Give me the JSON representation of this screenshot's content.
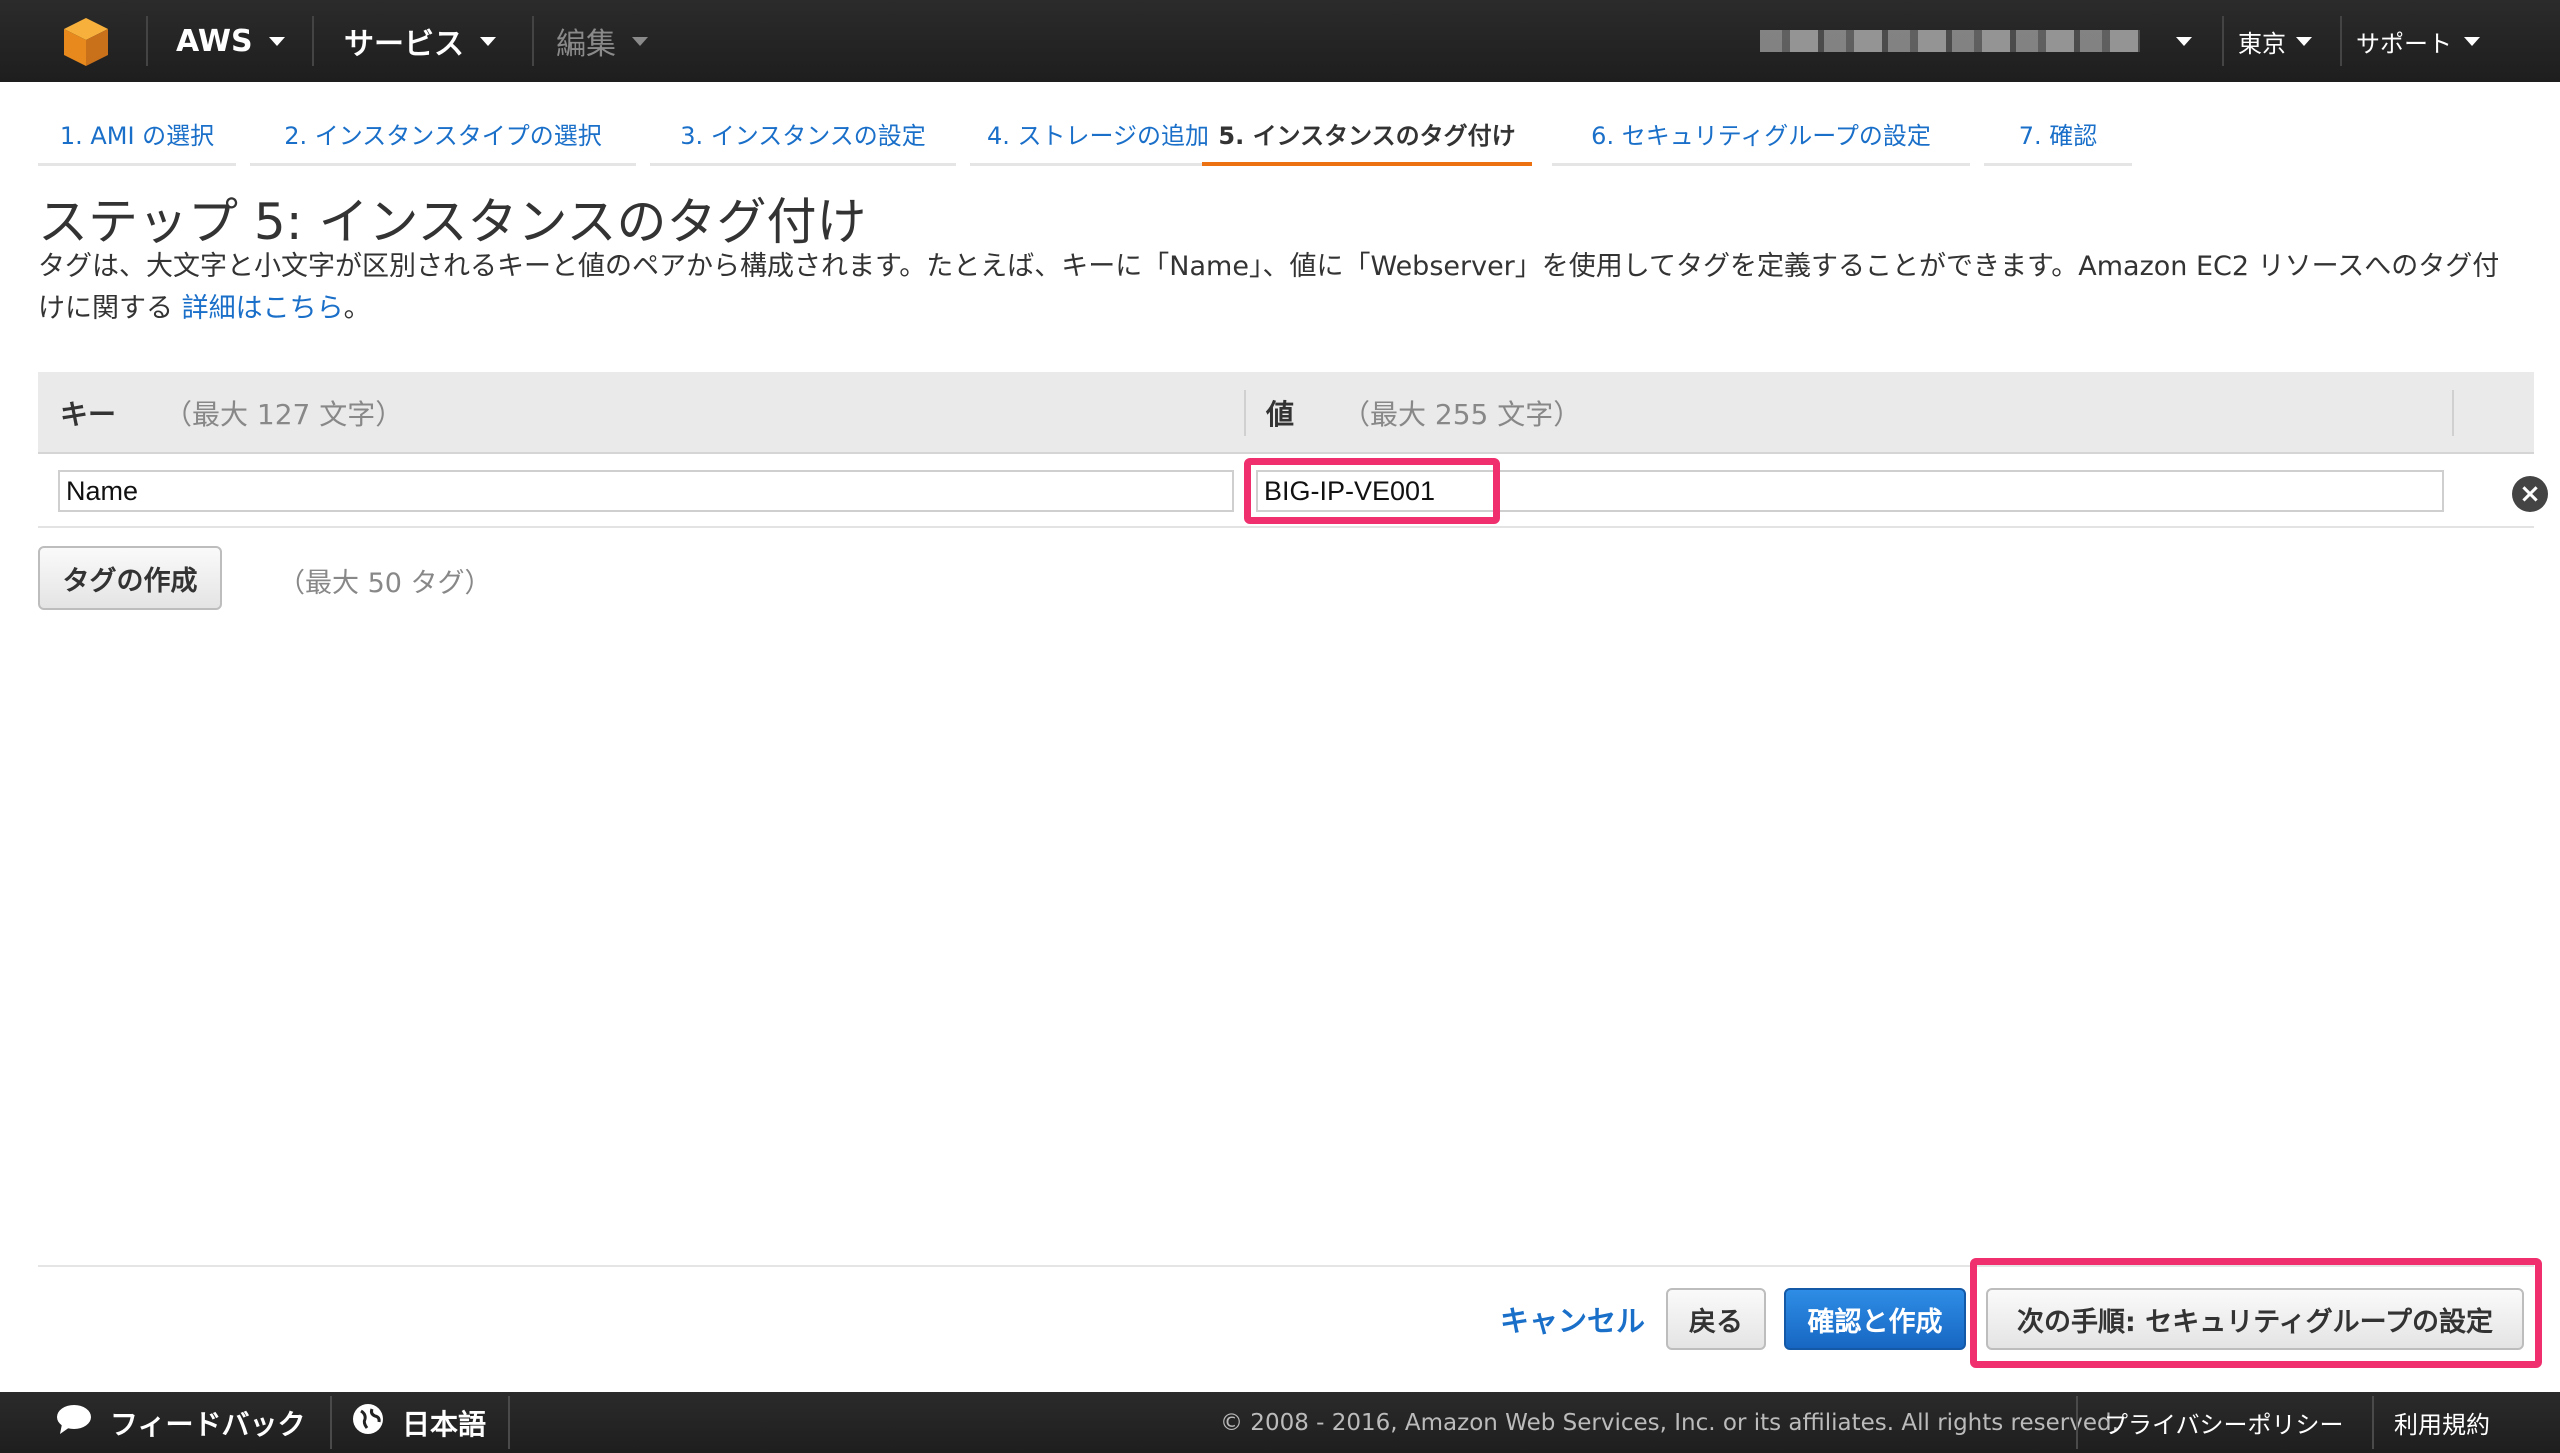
{
  "topnav": {
    "brand": "AWS",
    "services": "サービス",
    "edit": "編集",
    "region": "東京",
    "support": "サポート"
  },
  "wizard": {
    "tabs": [
      {
        "label": "1. AMI の選択"
      },
      {
        "label": "2. インスタンスタイプの選択"
      },
      {
        "label": "3. インスタンスの設定"
      },
      {
        "label": "4. ストレージの追加"
      },
      {
        "label": "5. インスタンスのタグ付け"
      },
      {
        "label": "6. セキュリティグループの設定"
      },
      {
        "label": "7. 確認"
      }
    ],
    "active_tab": 4
  },
  "page": {
    "title": "ステップ 5: インスタンスのタグ付け",
    "description": "タグは、大文字と小文字が区別されるキーと値のペアから構成されます。たとえば、キーに「Name」、値に「Webserver」を使用してタグを定義することができます。Amazon EC2 リソースへのタグ付けに関する",
    "details_link": "詳細はこちら",
    "description_end": "。"
  },
  "tag_table": {
    "key_header": "キー",
    "key_hint": "（最大 127 文字）",
    "value_header": "値",
    "value_hint": "（最大 255 文字）",
    "rows": [
      {
        "key": "Name",
        "value": "BIG-IP-VE001"
      }
    ],
    "add_tag_button": "タグの作成",
    "add_tag_hint": "（最大 50 タグ）"
  },
  "actions": {
    "cancel": "キャンセル",
    "back": "戻る",
    "review_launch": "確認と作成",
    "next": "次の手順: セキュリティグループの設定"
  },
  "footer": {
    "feedback": "フィードバック",
    "language": "日本語",
    "copyright": "© 2008 - 2016, Amazon Web Services, Inc. or its affiliates. All rights reserved.",
    "privacy": "プライバシーポリシー",
    "terms": "利用規約"
  },
  "colors": {
    "accent_orange": "#ec7211",
    "link_blue": "#1a6fc9",
    "highlight_pink": "#ef2f6e",
    "nav_dark": "#222222"
  }
}
